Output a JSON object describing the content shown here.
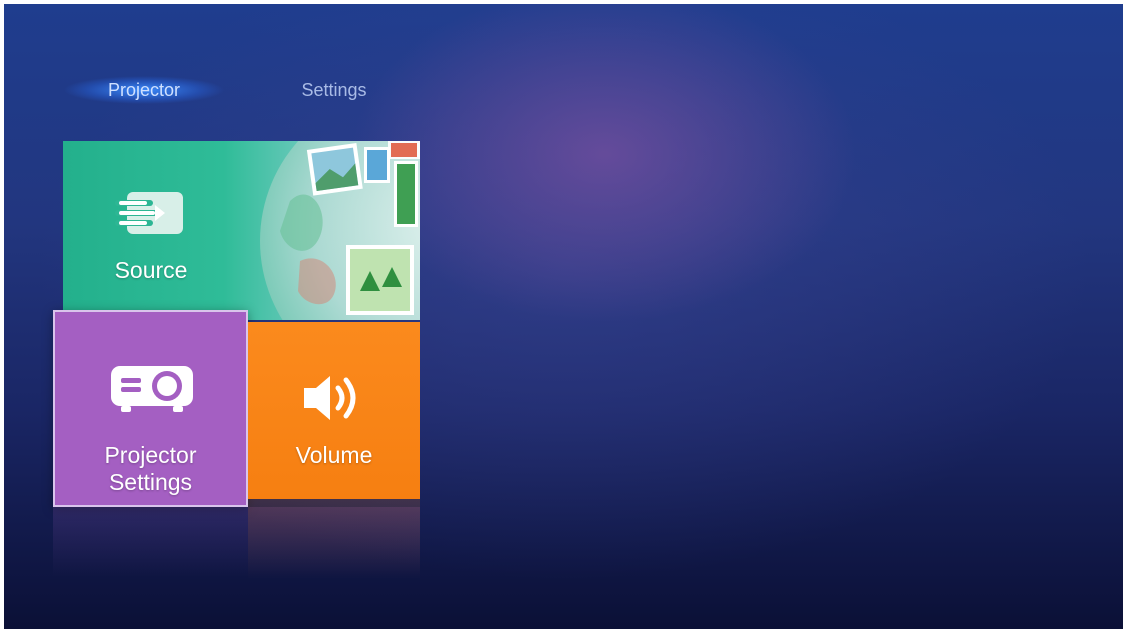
{
  "nav": {
    "tabs": [
      {
        "label": "Projector",
        "active": true
      },
      {
        "label": "Settings",
        "active": false
      }
    ]
  },
  "tiles": {
    "source": {
      "label": "Source",
      "icon": "source-input-icon",
      "color": "#2db694"
    },
    "projector_settings": {
      "label_line1": "Projector",
      "label_line2": "Settings",
      "icon": "projector-icon",
      "color": "#a45fc2"
    },
    "volume": {
      "label": "Volume",
      "icon": "speaker-volume-icon",
      "color": "#f67f11"
    }
  },
  "colors": {
    "background_top": "#1f3d8e",
    "background_bottom": "#0b1036",
    "active_tab_glow": "#3c8cff",
    "selected_border": "#d9c4ec"
  }
}
